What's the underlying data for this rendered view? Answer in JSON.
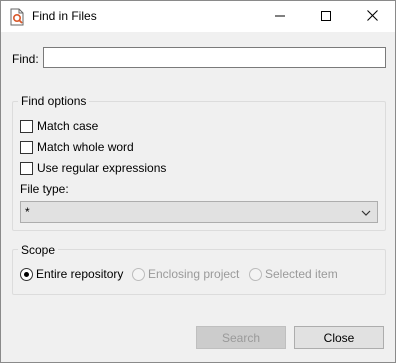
{
  "window": {
    "title": "Find in Files",
    "minimize_label": "minimize",
    "maximize_label": "maximize",
    "close_label": "close"
  },
  "find": {
    "label": "Find:",
    "value": ""
  },
  "find_options": {
    "legend": "Find options",
    "checkboxes": [
      {
        "label": "Match case",
        "checked": false
      },
      {
        "label": "Match whole word",
        "checked": false
      },
      {
        "label": "Use regular expressions",
        "checked": false
      }
    ],
    "file_type_label": "File type:",
    "file_type_value": "*"
  },
  "scope": {
    "legend": "Scope",
    "options": [
      {
        "label": "Entire repository",
        "selected": true,
        "enabled": true
      },
      {
        "label": "Enclosing project",
        "selected": false,
        "enabled": false
      },
      {
        "label": "Selected item",
        "selected": false,
        "enabled": false
      }
    ]
  },
  "buttons": {
    "search_label": "Search",
    "close_label": "Close"
  },
  "icons": {
    "app": "find-in-files-icon",
    "minimize": "minimize-icon",
    "maximize": "maximize-icon",
    "close": "close-icon",
    "dropdown": "chevron-down-icon"
  },
  "colors": {
    "accent": "#d9582a",
    "background": "#f0f0f0"
  }
}
